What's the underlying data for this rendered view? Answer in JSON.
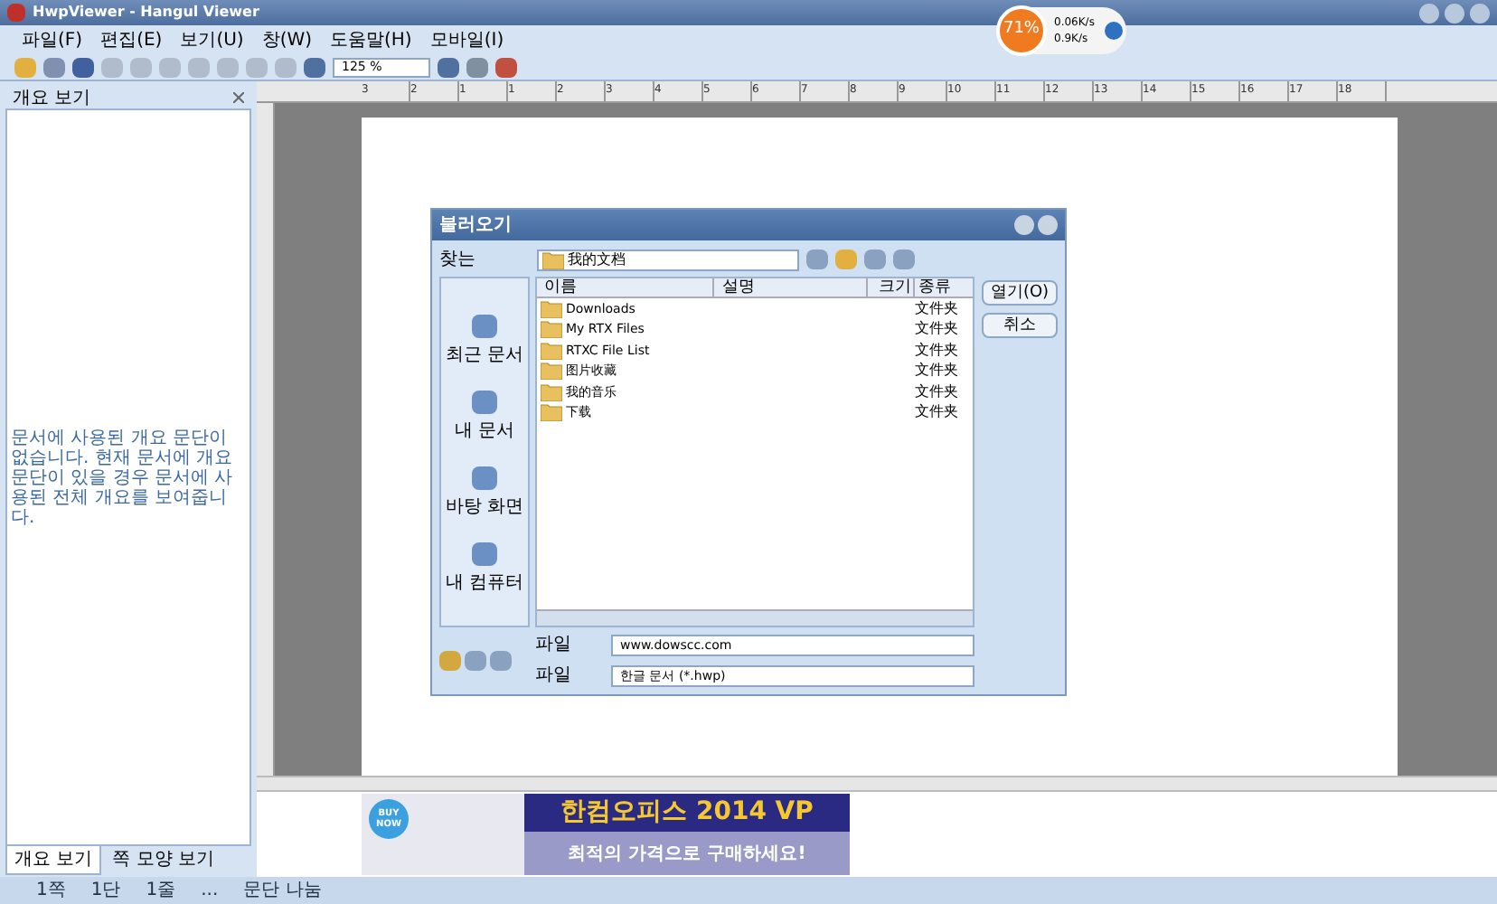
{
  "window": {
    "title": "HwpViewer - Hangul Viewer"
  },
  "menu": [
    "파일(F)",
    "편집(E)",
    "보기(U)",
    "창(W)",
    "도움말(H)",
    "모바일(I)"
  ],
  "toolbar": {
    "zoom": "125 %"
  },
  "net_widget": {
    "percent": "71%",
    "upload": "0.06K/s",
    "download": "0.9K/s"
  },
  "outline_panel": {
    "title": "개요 보기",
    "message": "문서에 사용된 개요 문단이 없습니다. 현재 문서에 개요 문단이 있을 경우 문서에 사용된 전체 개요를 보여줍니다.",
    "tabs": [
      {
        "label": "개요 보기",
        "selected": true
      },
      {
        "label": "쪽 모양 보기",
        "selected": false
      }
    ]
  },
  "ruler": {
    "labels": [
      "3",
      "2",
      "1",
      "1",
      "2",
      "3",
      "4",
      "5",
      "6",
      "7",
      "8",
      "9",
      "10",
      "11",
      "12",
      "13",
      "14",
      "15",
      "16",
      "17",
      "18"
    ]
  },
  "dialog": {
    "title": "불러오기",
    "look_in_label": "찾는",
    "path": "我的文档",
    "places": [
      "최근 문서",
      "내 문서",
      "바탕 화면",
      "내 컴퓨터"
    ],
    "columns": [
      "이름",
      "설명",
      "크기",
      "종류"
    ],
    "rows": [
      {
        "name": "Downloads",
        "type": "文件夹"
      },
      {
        "name": "My RTX Files",
        "type": "文件夹"
      },
      {
        "name": "RTXC File List",
        "type": "文件夹"
      },
      {
        "name": "图片收藏",
        "type": "文件夹"
      },
      {
        "name": "我的音乐",
        "type": "文件夹"
      },
      {
        "name": "下载",
        "type": "文件夹"
      }
    ],
    "buttons": [
      "열기(O)",
      "취소"
    ],
    "fields": [
      {
        "label": "파일",
        "value": "www.dowscc.com"
      },
      {
        "label": "파일",
        "value": "한글 문서 (*.hwp)"
      }
    ]
  },
  "ad": {
    "badge": "BUY NOW",
    "headline": "한컴오피스 2014 VP",
    "subline": "최적의 가격으로 구매하세요!"
  },
  "status_bar": [
    "1쪽",
    "1단",
    "1줄",
    "...",
    "문단 나눔"
  ]
}
